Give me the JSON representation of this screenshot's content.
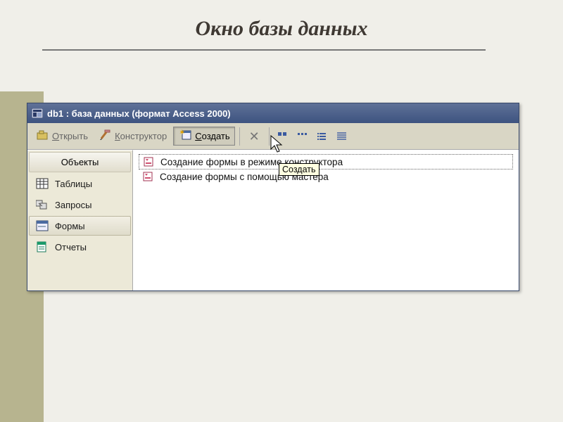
{
  "slide": {
    "title": "Окно базы данных"
  },
  "window": {
    "title": "db1 : база данных (формат Access 2000)"
  },
  "toolbar": {
    "open": "Открыть",
    "open_u": "О",
    "design": "Конструктор",
    "design_u": "К",
    "create": "Создать",
    "create_u": "С",
    "delete": "×"
  },
  "sidebar": {
    "header": "Объекты",
    "items": [
      {
        "label": "Таблицы",
        "icon": "table"
      },
      {
        "label": "Запросы",
        "icon": "query"
      },
      {
        "label": "Формы",
        "icon": "form",
        "selected": true
      },
      {
        "label": "Отчеты",
        "icon": "report"
      }
    ]
  },
  "main": {
    "items": [
      {
        "label": "Создание формы в режиме конструктора",
        "selected": true
      },
      {
        "label": "Создание формы с помощью мастера"
      }
    ]
  },
  "tooltip": "Создать"
}
